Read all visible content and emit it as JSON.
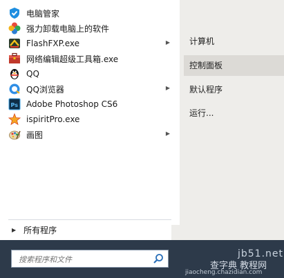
{
  "apps": [
    {
      "label": "电脑管家",
      "icon": "tencent-pc-manager-icon",
      "submenu": false
    },
    {
      "label": "强力卸载电脑上的软件",
      "icon": "uninstaller-petals-icon",
      "submenu": false
    },
    {
      "label": "FlashFXP.exe",
      "icon": "flashfxp-icon",
      "submenu": true
    },
    {
      "label": "网络编辑超级工具箱.exe",
      "icon": "toolbox-icon",
      "submenu": false
    },
    {
      "label": "QQ",
      "icon": "qq-penguin-icon",
      "submenu": false
    },
    {
      "label": "QQ浏览器",
      "icon": "qq-browser-icon",
      "submenu": true
    },
    {
      "label": "Adobe Photoshop CS6",
      "icon": "photoshop-icon",
      "submenu": false
    },
    {
      "label": "ispiritPro.exe",
      "icon": "ispirit-star-icon",
      "submenu": false
    },
    {
      "label": "画图",
      "icon": "paint-palette-icon",
      "submenu": true
    }
  ],
  "all_programs": {
    "label": "所有程序",
    "icon": "right-triangle-icon"
  },
  "right_items": [
    {
      "label": "计算机"
    },
    {
      "label": "控制面板",
      "selected": true
    },
    {
      "label": "默认程序"
    },
    {
      "label": "运行..."
    }
  ],
  "search": {
    "placeholder": "搜索程序和文件",
    "icon": "search-magnifier-icon"
  },
  "watermark": {
    "line1": "jb51.net",
    "line2": "查字典 教程网",
    "line3": "jiaocheng.chazidian.com"
  },
  "colors": {
    "taskbar": "#2d3a4a",
    "right_panel": "#eeedea",
    "selected": "#dcdad6"
  }
}
